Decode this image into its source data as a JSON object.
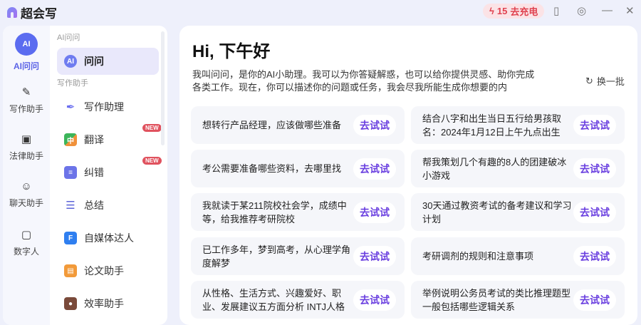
{
  "app": {
    "title": "超会写",
    "charge_count": "15",
    "charge_label": "去充电"
  },
  "rail": [
    {
      "label": "AI问问",
      "icon": "ai-icon"
    },
    {
      "label": "写作助手",
      "icon": "pen-icon"
    },
    {
      "label": "法律助手",
      "icon": "book-icon"
    },
    {
      "label": "聊天助手",
      "icon": "chat-icon"
    },
    {
      "label": "数字人",
      "icon": "digital-human-icon"
    }
  ],
  "nav": {
    "section1": "AI问问",
    "section2": "写作助手",
    "active": "问问",
    "items": [
      {
        "label": "写作助理"
      },
      {
        "label": "翻译",
        "badge": "NEW"
      },
      {
        "label": "纠错",
        "badge": "NEW"
      },
      {
        "label": "总结"
      },
      {
        "label": "自媒体达人"
      },
      {
        "label": "论文助手"
      },
      {
        "label": "效率助手"
      }
    ]
  },
  "main": {
    "greeting": "Hi, 下午好",
    "intro": "我叫问问，是你的AI小助理。我可以为你答疑解惑，也可以给你提供灵感、助你完成各类工作。现在，你可以描述你的问题或任务，我会尽我所能生成你想要的内",
    "refresh": "换一批",
    "try_label": "去试试",
    "prompts": [
      "想转行产品经理，应该做哪些准备",
      "结合八字和出生当日五行给男孩取名：2024年1月12日上午九点出生",
      "考公需要准备哪些资料，去哪里找",
      "帮我策划几个有趣的8人的团建破冰小游戏",
      "我就读于某211院校社会学，成绩中等，给我推荐考研院校",
      "30天通过教资考试的备考建议和学习计划",
      "已工作多年，梦到高考，从心理学角度解梦",
      "考研调剂的规则和注意事项",
      "从性格、生活方式、兴趣爱好、职业、发展建议五方面分析 INTJ人格",
      "举例说明公务员考试的类比推理题型一般包括哪些逻辑关系"
    ]
  }
}
